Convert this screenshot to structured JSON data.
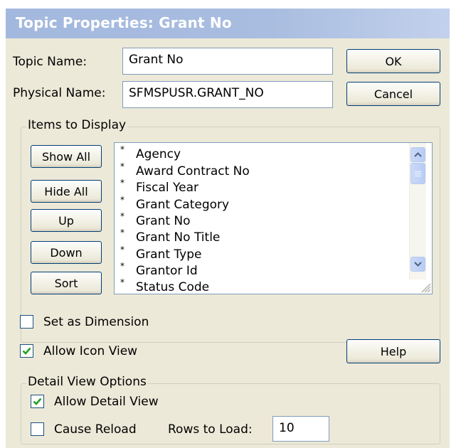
{
  "window": {
    "title": "Topic Properties: Grant No"
  },
  "fields": {
    "topic_name_label": "Topic Name:",
    "topic_name_value": "Grant No",
    "physical_name_label": "Physical Name:",
    "physical_name_value": "SFMSPUSR.GRANT_NO"
  },
  "buttons": {
    "ok": "OK",
    "cancel": "Cancel",
    "show_all": "Show All",
    "hide_all": "Hide All",
    "up": "Up",
    "down": "Down",
    "sort": "Sort",
    "help": "Help"
  },
  "items_group": {
    "title": "Items to Display",
    "mark": "*",
    "items": [
      "Agency",
      "Award Contract No",
      "Fiscal Year",
      "Grant Category",
      "Grant No",
      "Grant No Title",
      "Grant Type",
      "Grantor Id",
      "Status Code"
    ]
  },
  "options": {
    "set_as_dimension": {
      "label": "Set as Dimension",
      "checked": false
    },
    "allow_icon_view": {
      "label": "Allow Icon View",
      "checked": true
    }
  },
  "detail_group": {
    "title": "Detail View Options",
    "allow_detail_view": {
      "label": "Allow Detail View",
      "checked": true
    },
    "cause_reload": {
      "label": "Cause Reload",
      "checked": false
    },
    "rows_to_load_label": "Rows to Load:",
    "rows_to_load_value": "10"
  },
  "colors": {
    "title_bar": "#a9bde0",
    "dialog_face": "#ece9d8",
    "check_mark": "#21a121"
  }
}
